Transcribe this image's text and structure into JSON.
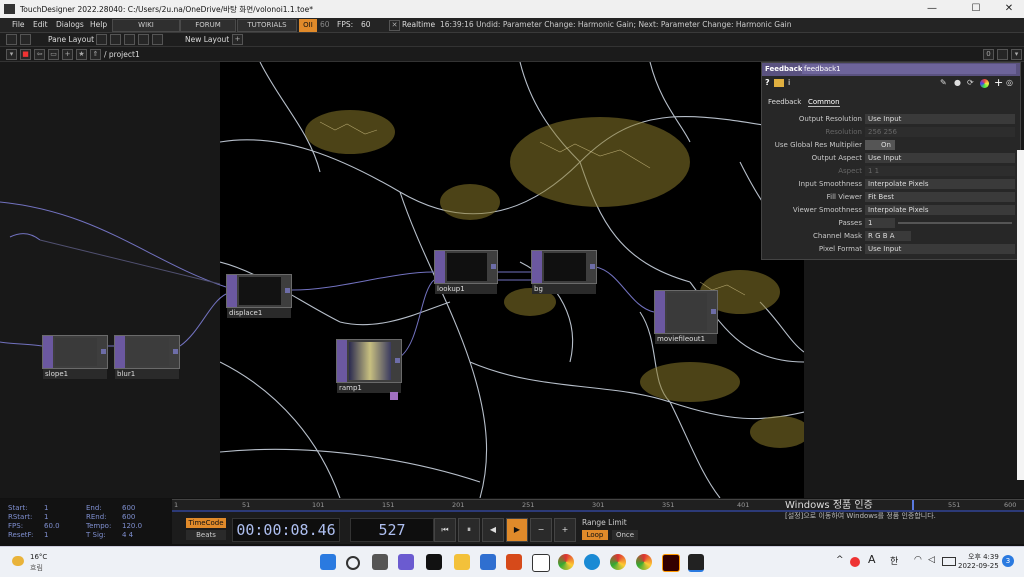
{
  "window": {
    "title": "TouchDesigner 2022.28040: C:/Users/2u.na/OneDrive/바탕 화면/volonoi1.1.toe*",
    "min": "—",
    "max": "☐",
    "close": "✕"
  },
  "menu": {
    "items": [
      "File",
      "Edit",
      "Dialogs",
      "Help"
    ],
    "wiki": "WIKI",
    "forum": "FORUM",
    "tutorials": "TUTORIALS",
    "oii": "OII",
    "fps_target": "60",
    "fps_label": "FPS:",
    "fps_value": "60",
    "realtime_check": "✕",
    "realtime": "Realtime",
    "status": "16:39:16 Undid: Parameter Change: Harmonic Gain; Next: Parameter Change: Harmonic Gain"
  },
  "layout": {
    "pane_layout": "Pane Layout",
    "new_layout": "New Layout",
    "plus": "+"
  },
  "path": {
    "text": "/ project1",
    "pane_num": "0"
  },
  "nodes": {
    "slope1": "slope1",
    "blur1": "blur1",
    "displace1": "displace1",
    "lookup1": "lookup1",
    "bg": "bg",
    "ramp1": "ramp1",
    "moviefileout1": "moviefileout1"
  },
  "params": {
    "op_type": "Feedback",
    "op_name": "feedback1",
    "tabs": [
      "Feedback",
      "Common"
    ],
    "rows": [
      {
        "label": "Output Resolution",
        "value": "Use Input"
      },
      {
        "label": "Resolution",
        "value": "256          256"
      },
      {
        "label": "Use Global Res Multiplier",
        "value": "On"
      },
      {
        "label": "Output Aspect",
        "value": "Use Input"
      },
      {
        "label": "Aspect",
        "value": "1                1"
      },
      {
        "label": "Input Smoothness",
        "value": "Interpolate Pixels"
      },
      {
        "label": "Fill Viewer",
        "value": "Fit Best"
      },
      {
        "label": "Viewer Smoothness",
        "value": "Interpolate Pixels"
      },
      {
        "label": "Passes",
        "value": "1"
      },
      {
        "label": "Channel Mask",
        "value": "R G B A"
      },
      {
        "label": "Pixel Format",
        "value": "Use Input"
      }
    ]
  },
  "ruler": {
    "ticks": [
      "1",
      "51",
      "101",
      "151",
      "201",
      "251",
      "301",
      "351",
      "401",
      "551",
      "600"
    ]
  },
  "info": {
    "start_l": "Start:",
    "start_v": "1",
    "end_l": "End:",
    "end_v": "600",
    "rstart_l": "RStart:",
    "rstart_v": "1",
    "rend_l": "REnd:",
    "rend_v": "600",
    "fps_l": "FPS:",
    "fps_v": "60.0",
    "tempo_l": "Tempo:",
    "tempo_v": "120.0",
    "resetf_l": "ResetF:",
    "resetf_v": "1",
    "tsig_l": "T Sig:",
    "tsig_v": "4     4"
  },
  "transport": {
    "timecode": "TimeCode",
    "beats": "Beats",
    "time": "00:00:08.46",
    "frame": "527",
    "range_limit": "Range Limit",
    "loop": "Loop",
    "once": "Once",
    "btn_start": "⏮",
    "btn_pause": "⏸",
    "btn_back": "◀",
    "btn_play": "▶",
    "btn_minus": "−",
    "btn_plus": "+"
  },
  "watermark": {
    "line1": "Windows 정품 인증",
    "line2": "[설정]으로 이동하여 Windows를 정품 인증합니다."
  },
  "taskbar": {
    "temp": "16°C",
    "weather": "흐림",
    "time": "오후 4:39",
    "date": "2022-09-25",
    "lang_a": "A",
    "lang_han": "한",
    "notif": "3"
  },
  "colors": {
    "accent": "#6b58a0",
    "orange": "#e08a2a",
    "param_header": "#5a5280"
  }
}
